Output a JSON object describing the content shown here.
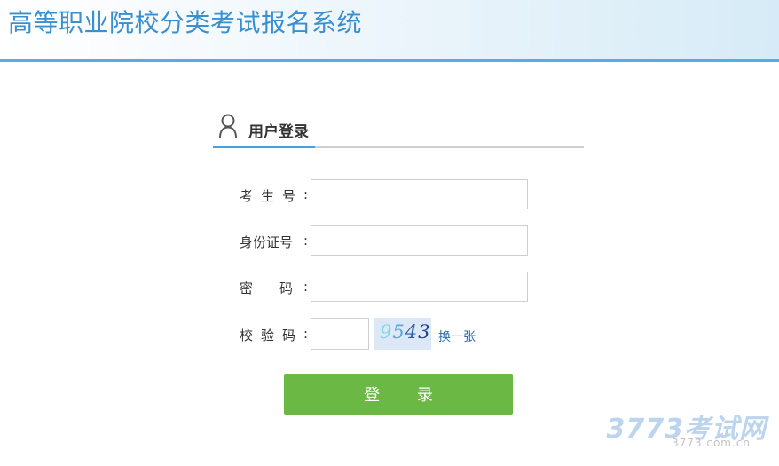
{
  "header": {
    "title": "高等职业院校分类考试报名系统"
  },
  "login_panel": {
    "title": "用户登录",
    "fields": {
      "exam_number_label": "考生号",
      "id_number_label": "身份证号",
      "password_label": "密码",
      "captcha_label": "校验码",
      "colon": ":"
    },
    "captcha": {
      "chars": [
        "9",
        "5",
        "4",
        "3"
      ],
      "colors": [
        "#7fd6e6",
        "#5aa7d8",
        "#2d5da8",
        "#1c3f8c"
      ]
    },
    "refresh_link": "换一张",
    "login_button": "登 录"
  },
  "watermark": {
    "brand": "3773考试网",
    "url": "3773.com.cn"
  },
  "colors": {
    "accent": "#4a9fdc",
    "header_text": "#3a8fcf",
    "button": "#6bb844"
  }
}
